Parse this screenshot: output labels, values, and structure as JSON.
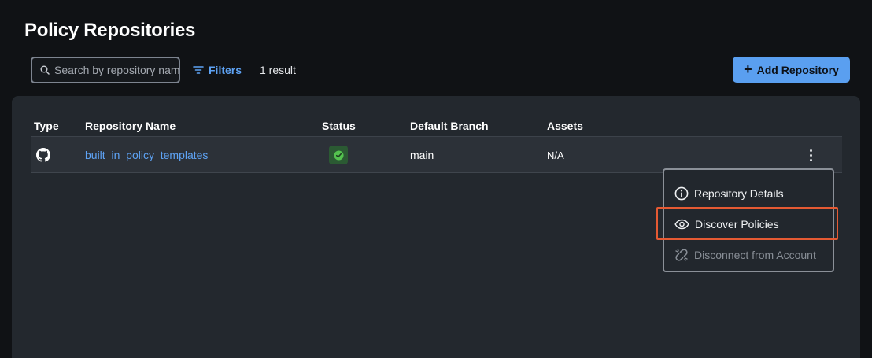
{
  "page": {
    "title": "Policy Repositories"
  },
  "toolbar": {
    "search_placeholder": "Search by repository name",
    "filters_label": "Filters",
    "result_count": "1 result",
    "add_label": "Add Repository"
  },
  "table": {
    "columns": [
      "Type",
      "Repository Name",
      "Status",
      "Default Branch",
      "Assets"
    ],
    "rows": [
      {
        "type_icon": "github-icon",
        "name": "built_in_policy_templates",
        "status_icon": "check-circle-icon",
        "branch": "main",
        "assets": "N/A"
      }
    ]
  },
  "menu": {
    "items": [
      {
        "label": "Repository Details",
        "icon": "info-icon",
        "disabled": false
      },
      {
        "label": "Discover Policies",
        "icon": "eye-icon",
        "disabled": false,
        "highlighted": true
      },
      {
        "label": "Disconnect from Account",
        "icon": "broken-link-icon",
        "disabled": true
      }
    ]
  },
  "colors": {
    "accent": "#5a9ff0",
    "link": "#5ea3f5",
    "status_success": "#2b5a33",
    "highlight": "#e55a33"
  }
}
